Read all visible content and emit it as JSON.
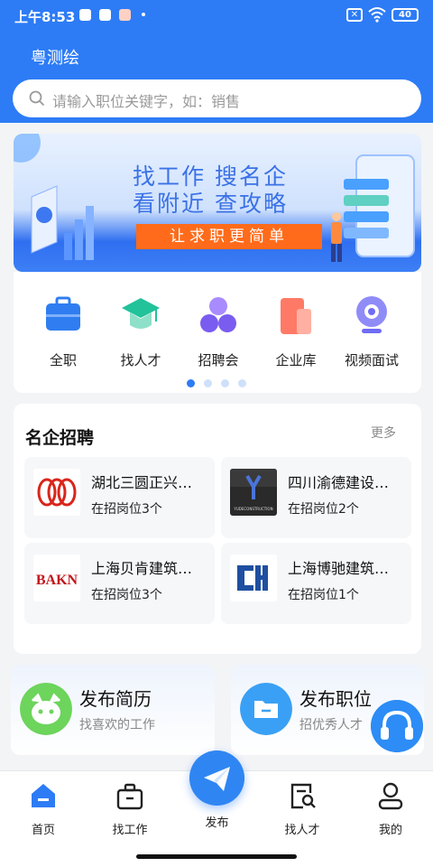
{
  "status": {
    "time": "上午8:53",
    "battery": "40",
    "mute": "✕"
  },
  "app": {
    "title": "粤测绘"
  },
  "search": {
    "placeholder": "请输入职位关键字，如：销售",
    "icon": "search-icon"
  },
  "banner": {
    "line1": "找工作  搜名企",
    "line2": "看附近  查攻略",
    "tagline": "让求职更简单"
  },
  "quick_links": [
    {
      "label": "全职",
      "icon": "briefcase-icon",
      "color": "#2f7df0"
    },
    {
      "label": "找人才",
      "icon": "graduation-cap-icon",
      "color": "#22c29a"
    },
    {
      "label": "招聘会",
      "icon": "people-icon",
      "color": "#7a5cf0"
    },
    {
      "label": "企业库",
      "icon": "building-icon",
      "color": "#ff6b5e"
    },
    {
      "label": "视频面试",
      "icon": "webcam-icon",
      "color": "#6f6cf5"
    }
  ],
  "pager": {
    "count": 4,
    "active": 1
  },
  "companies": {
    "title": "名企招聘",
    "more": "更多",
    "items": [
      {
        "name": "湖北三圆正兴…",
        "jobs": "在招岗位3个"
      },
      {
        "name": "四川渝德建设…",
        "jobs": "在招岗位2个",
        "logo_text": "YUDECONSTRUCTION"
      },
      {
        "name": "上海贝肯建筑…",
        "jobs": "在招岗位3个",
        "logo_text": "BAKN"
      },
      {
        "name": "上海博驰建筑…",
        "jobs": "在招岗位1个"
      }
    ]
  },
  "publish": [
    {
      "title": "发布简历",
      "subtitle": "找喜欢的工作",
      "icon": "resume-icon",
      "color": "#6dd45c"
    },
    {
      "title": "发布职位",
      "subtitle": "招优秀人才",
      "icon": "folder-icon",
      "color": "#3aa0f5"
    }
  ],
  "nav": {
    "items": [
      {
        "label": "首页",
        "icon": "home-icon"
      },
      {
        "label": "找工作",
        "icon": "briefcase-icon"
      },
      {
        "label": "发布",
        "icon": "send-icon"
      },
      {
        "label": "找人才",
        "icon": "search-doc-icon"
      },
      {
        "label": "我的",
        "icon": "user-icon"
      }
    ],
    "active_color": "#2d7cf6"
  }
}
